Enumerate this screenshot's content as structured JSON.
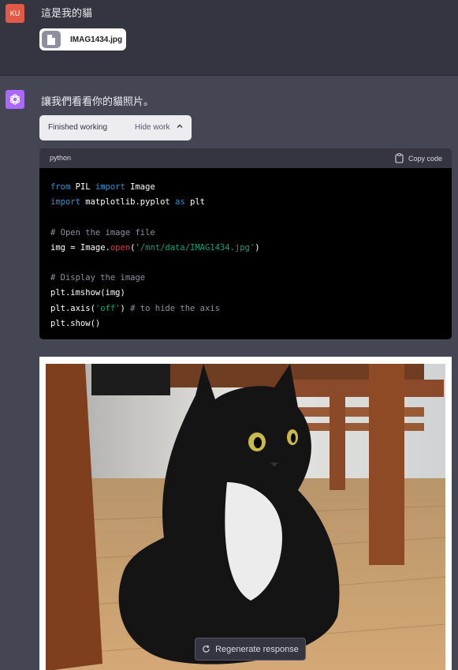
{
  "user_message": {
    "avatar": "KU",
    "text": "這是我的貓",
    "file_name": "IMAG1434.jpg"
  },
  "assistant": {
    "text": "讓我們看看你的貓照片。",
    "work_status": "Finished working",
    "hide_work_label": "Hide work",
    "code_language": "python",
    "copy_label": "Copy code",
    "code_lines": [
      "from PIL import Image",
      "import matplotlib.pyplot as plt",
      "",
      "# Open the image file",
      "img = Image.open('/mnt/data/IMAG1434.jpg')",
      "",
      "# Display the image",
      "plt.imshow(img)",
      "plt.axis('off') # to hide the axis",
      "plt.show()"
    ]
  },
  "regenerate_label": "Regenerate response",
  "colors": {
    "user_avatar": "#e05a47",
    "assistant_avatar": "#ab68ff",
    "code_bg": "#000000"
  }
}
